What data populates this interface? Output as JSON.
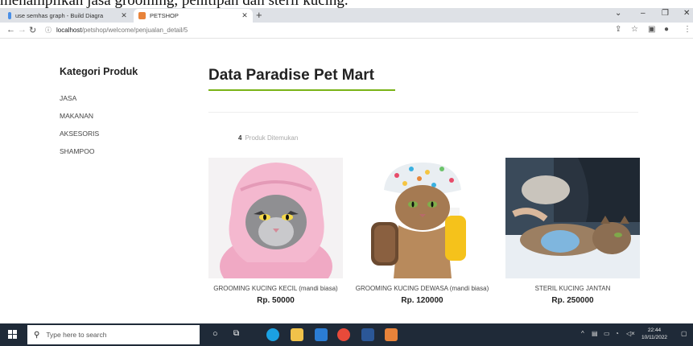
{
  "caption_fragment": "menampilkan jasa grooming, penitipan dan steril kucing.",
  "browser": {
    "tabs": [
      {
        "title": "use semhas graph - Build Diagra",
        "active": false,
        "favicon_color": "#4a8fe7"
      },
      {
        "title": "PETSHOP",
        "active": true,
        "favicon_color": "#e8833a"
      }
    ],
    "url_host": "localhost",
    "url_path": "/petshop/welcome/penjualan_detail/5"
  },
  "sidebar": {
    "title": "Kategori Produk",
    "categories": [
      "JASA",
      "MAKANAN",
      "AKSESORIS",
      "SHAMPOO"
    ]
  },
  "main": {
    "title": "Data Paradise Pet Mart",
    "found_count": "4",
    "found_label": "Produk Ditemukan",
    "accent_color": "#7ab317",
    "products": [
      {
        "name": "GROOMING KUCING KECIL (mandi biasa)",
        "price": "Rp. 50000"
      },
      {
        "name": "GROOMING KUCING DEWASA (mandi biasa)",
        "price": "Rp. 120000"
      },
      {
        "name": "STERIL KUCING JANTAN",
        "price": "Rp. 250000"
      }
    ]
  },
  "taskbar": {
    "search_placeholder": "Type here to search",
    "time": "22:44",
    "date": "10/11/2022"
  }
}
